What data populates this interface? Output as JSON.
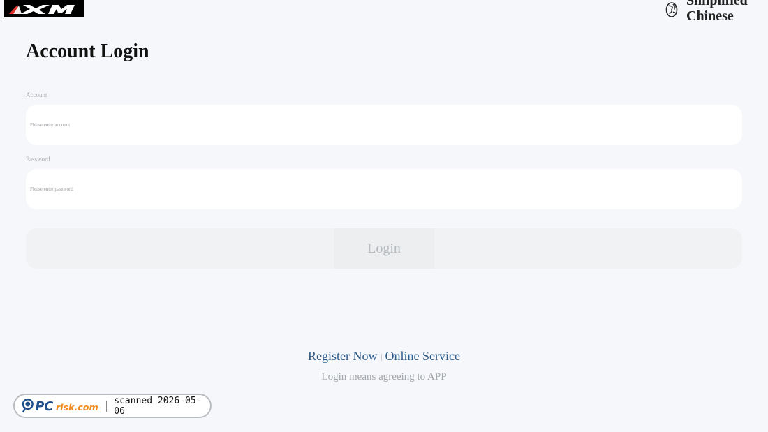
{
  "header": {
    "logo_text": "XM",
    "language": "Simplified Chinese"
  },
  "title": "Account Login",
  "form": {
    "account_label": "Account",
    "account_placeholder": "Please enter account",
    "account_value": "",
    "password_label": "Password",
    "password_placeholder": "Please enter password",
    "password_value": "",
    "login_button": "Login"
  },
  "footer": {
    "register_link": "Register Now",
    "service_link": "Online Service",
    "agreement_text": "Login means agreeing to APP"
  },
  "watermark": {
    "logo_text": "PCrisk.com",
    "scan_text": "scanned 2026-05-06"
  },
  "colors": {
    "background": "#f5f7fa",
    "link": "#2d5b8a",
    "logo_accent": "#e0302a",
    "watermark_orange": "#f08a1c"
  },
  "icons": {
    "language": "globe-icon"
  }
}
